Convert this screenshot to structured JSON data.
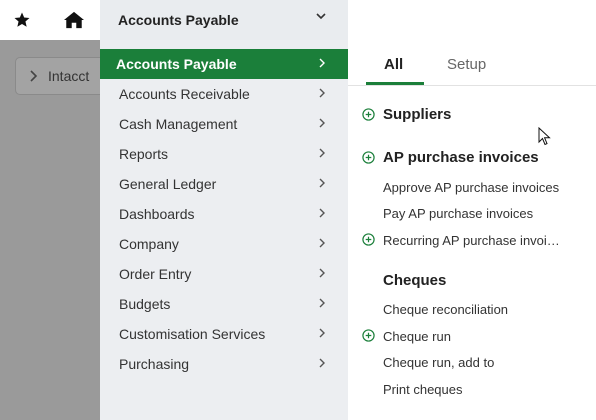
{
  "topbar": {
    "star_icon": "star-icon",
    "home_icon": "home-icon",
    "module_selected": "Accounts Payable"
  },
  "background": {
    "breadcrumb": "Intacct"
  },
  "menu": {
    "items": [
      {
        "label": "Accounts Payable",
        "active": true
      },
      {
        "label": "Accounts Receivable"
      },
      {
        "label": "Cash Management"
      },
      {
        "label": "Reports"
      },
      {
        "label": "General Ledger"
      },
      {
        "label": "Dashboards"
      },
      {
        "label": "Company"
      },
      {
        "label": "Order Entry"
      },
      {
        "label": "Budgets"
      },
      {
        "label": "Customisation Services"
      },
      {
        "label": "Purchasing"
      }
    ]
  },
  "panel": {
    "tabs": [
      {
        "label": "All",
        "active": true
      },
      {
        "label": "Setup"
      }
    ],
    "sections": [
      {
        "title": "Suppliers",
        "add": true
      },
      {
        "title": "AP purchase invoices",
        "add": true,
        "links": [
          {
            "label": "Approve AP purchase invoices"
          },
          {
            "label": "Pay AP purchase invoices"
          },
          {
            "label": "Recurring AP purchase invoi…",
            "add": true
          }
        ]
      },
      {
        "title": "Cheques",
        "links": [
          {
            "label": "Cheque reconciliation"
          },
          {
            "label": "Cheque run",
            "add": true
          },
          {
            "label": "Cheque run, add to"
          },
          {
            "label": "Print cheques"
          }
        ]
      }
    ]
  },
  "colors": {
    "accent": "#1b7f3a"
  }
}
